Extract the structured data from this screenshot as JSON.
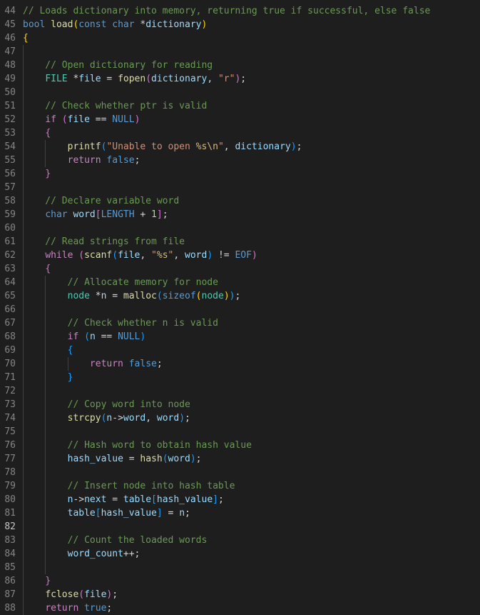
{
  "editor": {
    "active_line": "82",
    "lines": [
      {
        "n": "44",
        "tokens": [
          {
            "t": "// Loads dictionary into memory, returning true if successful, else false",
            "c": "com"
          }
        ]
      },
      {
        "n": "45",
        "tokens": [
          {
            "t": "bool",
            "c": "kw"
          },
          {
            "t": " ",
            "c": "op"
          },
          {
            "t": "load",
            "c": "fn"
          },
          {
            "t": "(",
            "c": "p1"
          },
          {
            "t": "const",
            "c": "kw"
          },
          {
            "t": " ",
            "c": "op"
          },
          {
            "t": "char",
            "c": "kw"
          },
          {
            "t": " *",
            "c": "op"
          },
          {
            "t": "dictionary",
            "c": "var"
          },
          {
            "t": ")",
            "c": "p1"
          }
        ]
      },
      {
        "n": "46",
        "tokens": [
          {
            "t": "{",
            "c": "p1"
          }
        ]
      },
      {
        "n": "47",
        "tokens": []
      },
      {
        "n": "48",
        "tokens": [
          {
            "t": "    // Open dictionary for reading",
            "c": "com"
          }
        ]
      },
      {
        "n": "49",
        "tokens": [
          {
            "t": "    ",
            "c": "op"
          },
          {
            "t": "FILE",
            "c": "typ"
          },
          {
            "t": " *",
            "c": "op"
          },
          {
            "t": "file",
            "c": "var"
          },
          {
            "t": " = ",
            "c": "op"
          },
          {
            "t": "fopen",
            "c": "fn"
          },
          {
            "t": "(",
            "c": "p2"
          },
          {
            "t": "dictionary",
            "c": "var"
          },
          {
            "t": ", ",
            "c": "op"
          },
          {
            "t": "\"r\"",
            "c": "str"
          },
          {
            "t": ")",
            "c": "p2"
          },
          {
            "t": ";",
            "c": "op"
          }
        ]
      },
      {
        "n": "50",
        "tokens": []
      },
      {
        "n": "51",
        "tokens": [
          {
            "t": "    // Check whether ptr is valid",
            "c": "com"
          }
        ]
      },
      {
        "n": "52",
        "tokens": [
          {
            "t": "    ",
            "c": "op"
          },
          {
            "t": "if",
            "c": "ctl"
          },
          {
            "t": " ",
            "c": "op"
          },
          {
            "t": "(",
            "c": "p2"
          },
          {
            "t": "file",
            "c": "var"
          },
          {
            "t": " == ",
            "c": "op"
          },
          {
            "t": "NULL",
            "c": "mac"
          },
          {
            "t": ")",
            "c": "p2"
          }
        ]
      },
      {
        "n": "53",
        "tokens": [
          {
            "t": "    ",
            "c": "op"
          },
          {
            "t": "{",
            "c": "p2"
          }
        ]
      },
      {
        "n": "54",
        "tokens": [
          {
            "t": "        ",
            "c": "op"
          },
          {
            "t": "printf",
            "c": "fn"
          },
          {
            "t": "(",
            "c": "p3"
          },
          {
            "t": "\"Unable to open ",
            "c": "str"
          },
          {
            "t": "%s\\n",
            "c": "esc"
          },
          {
            "t": "\"",
            "c": "str"
          },
          {
            "t": ", ",
            "c": "op"
          },
          {
            "t": "dictionary",
            "c": "var"
          },
          {
            "t": ")",
            "c": "p3"
          },
          {
            "t": ";",
            "c": "op"
          }
        ]
      },
      {
        "n": "55",
        "tokens": [
          {
            "t": "        ",
            "c": "op"
          },
          {
            "t": "return",
            "c": "ctl"
          },
          {
            "t": " ",
            "c": "op"
          },
          {
            "t": "false",
            "c": "kw"
          },
          {
            "t": ";",
            "c": "op"
          }
        ]
      },
      {
        "n": "56",
        "tokens": [
          {
            "t": "    ",
            "c": "op"
          },
          {
            "t": "}",
            "c": "p2"
          }
        ]
      },
      {
        "n": "57",
        "tokens": []
      },
      {
        "n": "58",
        "tokens": [
          {
            "t": "    // Declare variable word",
            "c": "com"
          }
        ]
      },
      {
        "n": "59",
        "tokens": [
          {
            "t": "    ",
            "c": "op"
          },
          {
            "t": "char",
            "c": "kw"
          },
          {
            "t": " ",
            "c": "op"
          },
          {
            "t": "word",
            "c": "var"
          },
          {
            "t": "[",
            "c": "p2"
          },
          {
            "t": "LENGTH",
            "c": "mac"
          },
          {
            "t": " + ",
            "c": "op"
          },
          {
            "t": "1",
            "c": "num"
          },
          {
            "t": "]",
            "c": "p2"
          },
          {
            "t": ";",
            "c": "op"
          }
        ]
      },
      {
        "n": "60",
        "tokens": []
      },
      {
        "n": "61",
        "tokens": [
          {
            "t": "    // Read strings from file",
            "c": "com"
          }
        ]
      },
      {
        "n": "62",
        "tokens": [
          {
            "t": "    ",
            "c": "op"
          },
          {
            "t": "while",
            "c": "ctl"
          },
          {
            "t": " ",
            "c": "op"
          },
          {
            "t": "(",
            "c": "p2"
          },
          {
            "t": "scanf",
            "c": "fn"
          },
          {
            "t": "(",
            "c": "p3"
          },
          {
            "t": "file",
            "c": "var"
          },
          {
            "t": ", ",
            "c": "op"
          },
          {
            "t": "\"",
            "c": "str"
          },
          {
            "t": "%s",
            "c": "esc"
          },
          {
            "t": "\"",
            "c": "str"
          },
          {
            "t": ", ",
            "c": "op"
          },
          {
            "t": "word",
            "c": "var"
          },
          {
            "t": ")",
            "c": "p3"
          },
          {
            "t": " != ",
            "c": "op"
          },
          {
            "t": "EOF",
            "c": "mac"
          },
          {
            "t": ")",
            "c": "p2"
          }
        ]
      },
      {
        "n": "63",
        "tokens": [
          {
            "t": "    ",
            "c": "op"
          },
          {
            "t": "{",
            "c": "p2"
          }
        ]
      },
      {
        "n": "64",
        "tokens": [
          {
            "t": "        // Allocate memory for node",
            "c": "com"
          }
        ]
      },
      {
        "n": "65",
        "tokens": [
          {
            "t": "        ",
            "c": "op"
          },
          {
            "t": "node",
            "c": "typ"
          },
          {
            "t": " *",
            "c": "op"
          },
          {
            "t": "n",
            "c": "var"
          },
          {
            "t": " = ",
            "c": "op"
          },
          {
            "t": "malloc",
            "c": "fn"
          },
          {
            "t": "(",
            "c": "p3"
          },
          {
            "t": "sizeof",
            "c": "kw"
          },
          {
            "t": "(",
            "c": "p1"
          },
          {
            "t": "node",
            "c": "typ"
          },
          {
            "t": ")",
            "c": "p1"
          },
          {
            "t": ")",
            "c": "p3"
          },
          {
            "t": ";",
            "c": "op"
          }
        ]
      },
      {
        "n": "66",
        "tokens": []
      },
      {
        "n": "67",
        "tokens": [
          {
            "t": "        // Check whether n is valid",
            "c": "com"
          }
        ]
      },
      {
        "n": "68",
        "tokens": [
          {
            "t": "        ",
            "c": "op"
          },
          {
            "t": "if",
            "c": "ctl"
          },
          {
            "t": " ",
            "c": "op"
          },
          {
            "t": "(",
            "c": "p3"
          },
          {
            "t": "n",
            "c": "var"
          },
          {
            "t": " == ",
            "c": "op"
          },
          {
            "t": "NULL",
            "c": "mac"
          },
          {
            "t": ")",
            "c": "p3"
          }
        ]
      },
      {
        "n": "69",
        "tokens": [
          {
            "t": "        ",
            "c": "op"
          },
          {
            "t": "{",
            "c": "p3"
          }
        ]
      },
      {
        "n": "70",
        "tokens": [
          {
            "t": "            ",
            "c": "op"
          },
          {
            "t": "return",
            "c": "ctl"
          },
          {
            "t": " ",
            "c": "op"
          },
          {
            "t": "false",
            "c": "kw"
          },
          {
            "t": ";",
            "c": "op"
          }
        ]
      },
      {
        "n": "71",
        "tokens": [
          {
            "t": "        ",
            "c": "op"
          },
          {
            "t": "}",
            "c": "p3"
          }
        ]
      },
      {
        "n": "72",
        "tokens": []
      },
      {
        "n": "73",
        "tokens": [
          {
            "t": "        // Copy word into node",
            "c": "com"
          }
        ]
      },
      {
        "n": "74",
        "tokens": [
          {
            "t": "        ",
            "c": "op"
          },
          {
            "t": "strcpy",
            "c": "fn"
          },
          {
            "t": "(",
            "c": "p3"
          },
          {
            "t": "n",
            "c": "var"
          },
          {
            "t": "->",
            "c": "op"
          },
          {
            "t": "word",
            "c": "var"
          },
          {
            "t": ", ",
            "c": "op"
          },
          {
            "t": "word",
            "c": "var"
          },
          {
            "t": ")",
            "c": "p3"
          },
          {
            "t": ";",
            "c": "op"
          }
        ]
      },
      {
        "n": "75",
        "tokens": []
      },
      {
        "n": "76",
        "tokens": [
          {
            "t": "        // Hash word to obtain hash value",
            "c": "com"
          }
        ]
      },
      {
        "n": "77",
        "tokens": [
          {
            "t": "        ",
            "c": "op"
          },
          {
            "t": "hash_value",
            "c": "var"
          },
          {
            "t": " = ",
            "c": "op"
          },
          {
            "t": "hash",
            "c": "fn"
          },
          {
            "t": "(",
            "c": "p3"
          },
          {
            "t": "word",
            "c": "var"
          },
          {
            "t": ")",
            "c": "p3"
          },
          {
            "t": ";",
            "c": "op"
          }
        ]
      },
      {
        "n": "78",
        "tokens": []
      },
      {
        "n": "79",
        "tokens": [
          {
            "t": "        // Insert node into hash table",
            "c": "com"
          }
        ]
      },
      {
        "n": "80",
        "tokens": [
          {
            "t": "        ",
            "c": "op"
          },
          {
            "t": "n",
            "c": "var"
          },
          {
            "t": "->",
            "c": "op"
          },
          {
            "t": "next",
            "c": "var"
          },
          {
            "t": " = ",
            "c": "op"
          },
          {
            "t": "table",
            "c": "var"
          },
          {
            "t": "[",
            "c": "p3"
          },
          {
            "t": "hash_value",
            "c": "var"
          },
          {
            "t": "]",
            "c": "p3"
          },
          {
            "t": ";",
            "c": "op"
          }
        ]
      },
      {
        "n": "81",
        "tokens": [
          {
            "t": "        ",
            "c": "op"
          },
          {
            "t": "table",
            "c": "var"
          },
          {
            "t": "[",
            "c": "p3"
          },
          {
            "t": "hash_value",
            "c": "var"
          },
          {
            "t": "]",
            "c": "p3"
          },
          {
            "t": " = ",
            "c": "op"
          },
          {
            "t": "n",
            "c": "var"
          },
          {
            "t": ";",
            "c": "op"
          }
        ]
      },
      {
        "n": "82",
        "tokens": []
      },
      {
        "n": "83",
        "tokens": [
          {
            "t": "        // Count the loaded words",
            "c": "com"
          }
        ]
      },
      {
        "n": "84",
        "tokens": [
          {
            "t": "        ",
            "c": "op"
          },
          {
            "t": "word_count",
            "c": "var"
          },
          {
            "t": "++;",
            "c": "op"
          }
        ]
      },
      {
        "n": "85",
        "tokens": []
      },
      {
        "n": "86",
        "tokens": [
          {
            "t": "    ",
            "c": "op"
          },
          {
            "t": "}",
            "c": "p2"
          }
        ]
      },
      {
        "n": "87",
        "tokens": [
          {
            "t": "    ",
            "c": "op"
          },
          {
            "t": "fclose",
            "c": "fn"
          },
          {
            "t": "(",
            "c": "p2"
          },
          {
            "t": "file",
            "c": "var"
          },
          {
            "t": ")",
            "c": "p2"
          },
          {
            "t": ";",
            "c": "op"
          }
        ]
      },
      {
        "n": "88",
        "tokens": [
          {
            "t": "    ",
            "c": "op"
          },
          {
            "t": "return",
            "c": "ctl"
          },
          {
            "t": " ",
            "c": "op"
          },
          {
            "t": "true",
            "c": "kw"
          },
          {
            "t": ";",
            "c": "op"
          }
        ]
      }
    ]
  },
  "theme": {
    "background": "#1e1e1e",
    "comment": "#6a9955",
    "keyword": "#569cd6",
    "control": "#c586c0",
    "function": "#dcdcaa",
    "variable": "#9cdcfe",
    "string": "#ce9178",
    "type": "#4ec9b0"
  }
}
